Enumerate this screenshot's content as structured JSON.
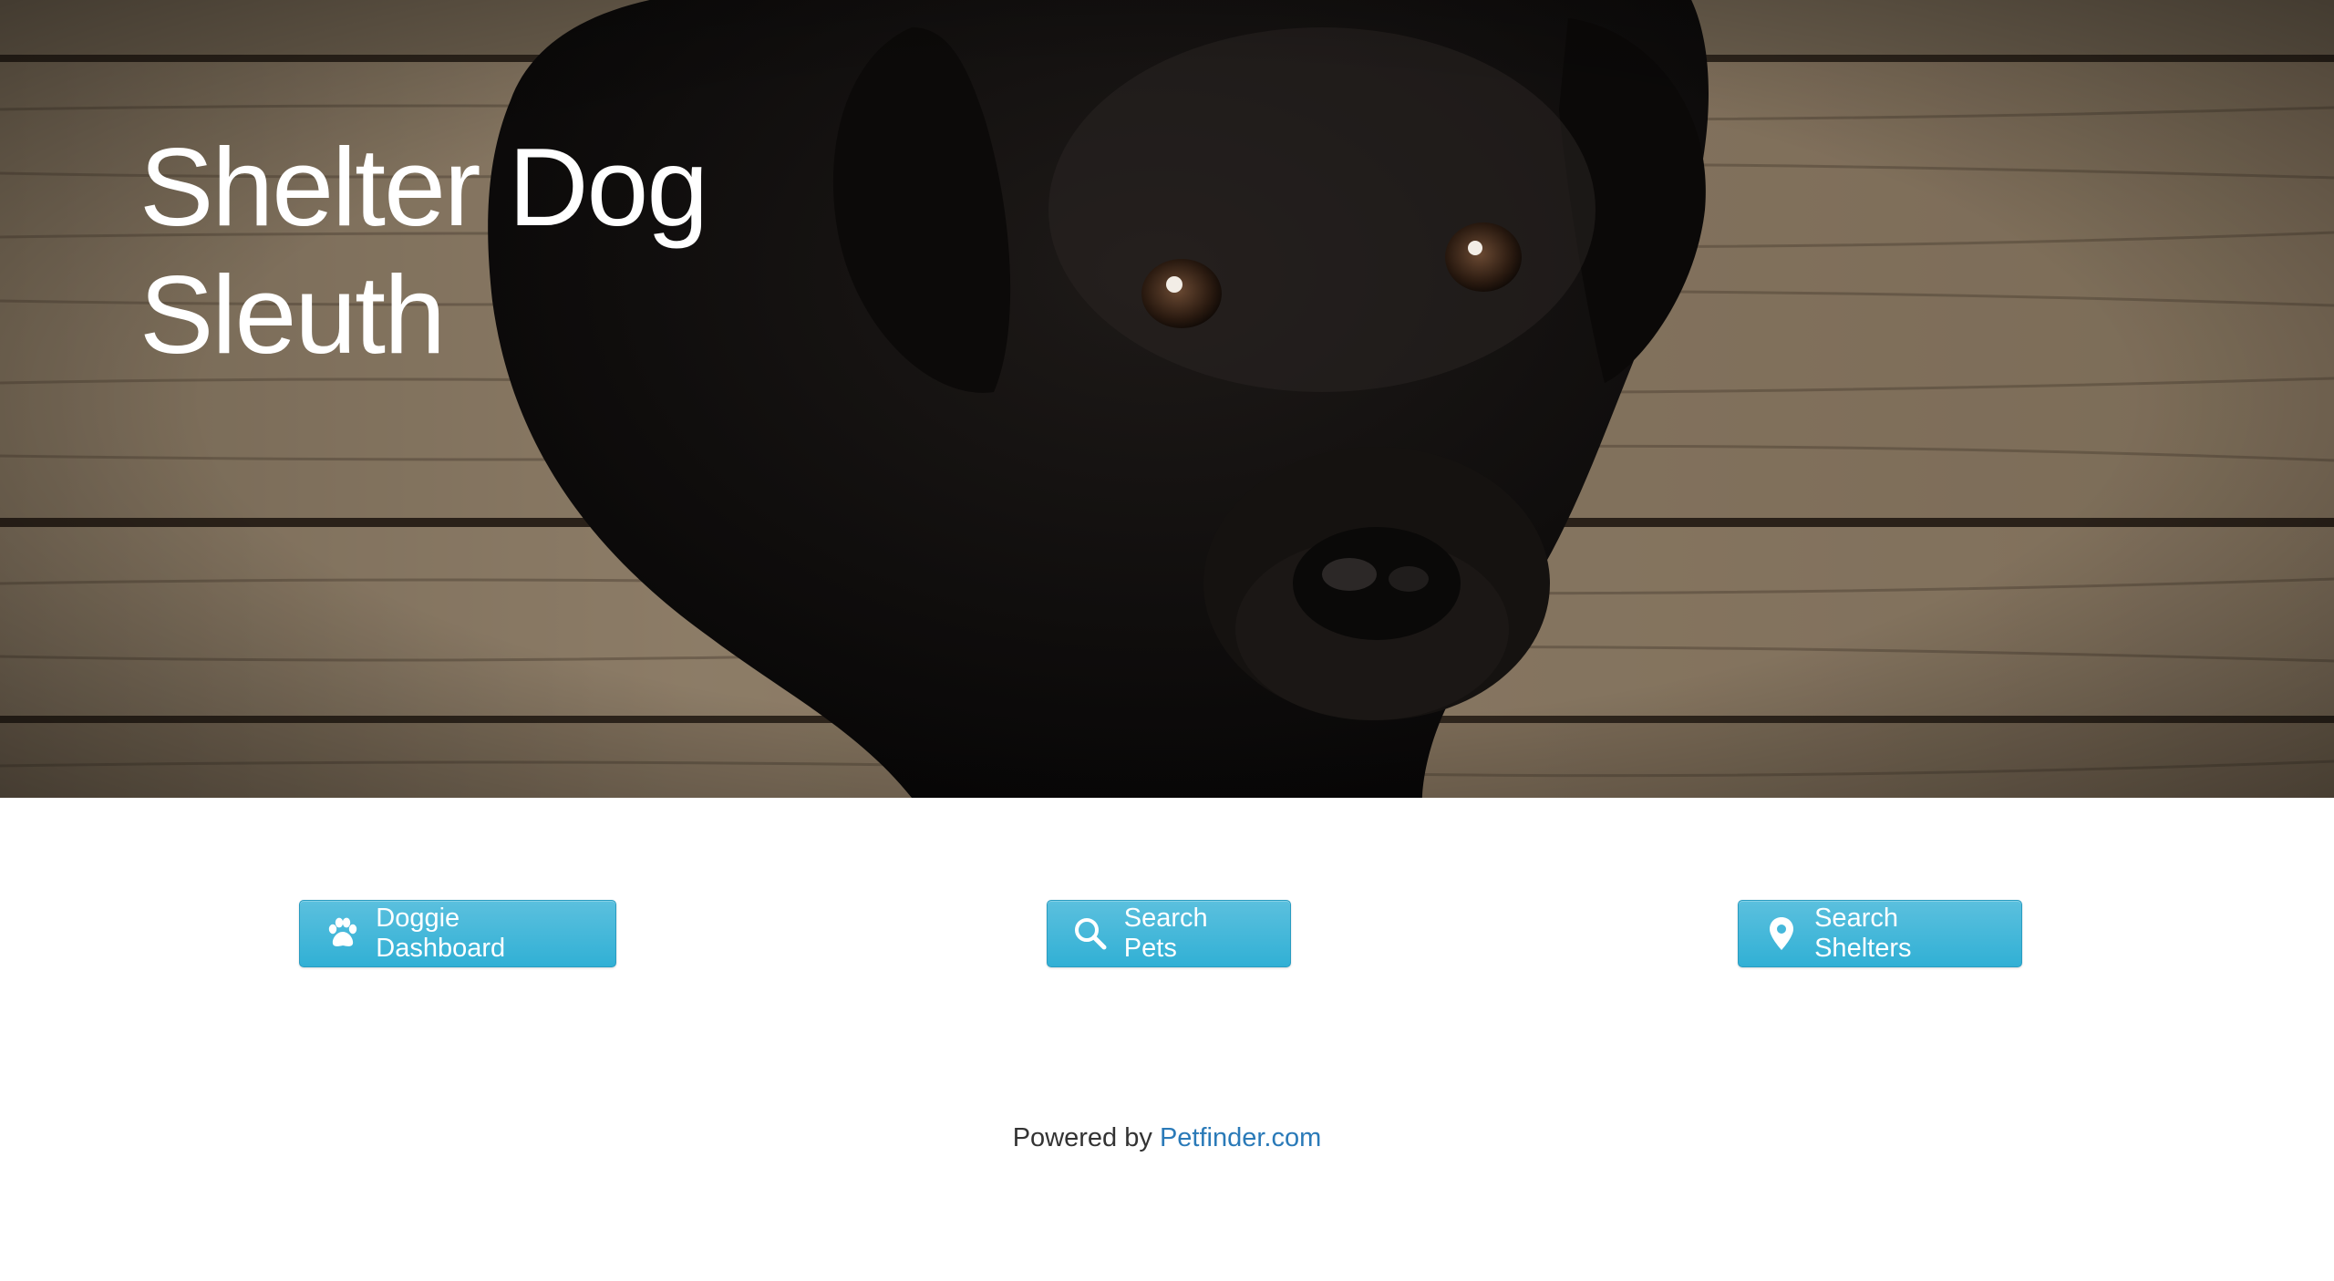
{
  "hero": {
    "title_line1": "Shelter Dog",
    "title_line2": "Sleuth",
    "image": "black-labrador-puppy-on-wooden-floor"
  },
  "actions": {
    "dashboard": {
      "label": "Doggie Dashboard",
      "icon": "paw-icon"
    },
    "pets": {
      "label": "Search Pets",
      "icon": "search-icon"
    },
    "shelters": {
      "label": "Search Shelters",
      "icon": "map-marker-icon"
    }
  },
  "footer": {
    "prefix": "Powered by",
    "link_text": "Petfinder.com"
  },
  "colors": {
    "button_bg": "#5bc0de",
    "button_border": "#2a9cc1",
    "link": "#2a7ab8",
    "text": "#333333"
  }
}
